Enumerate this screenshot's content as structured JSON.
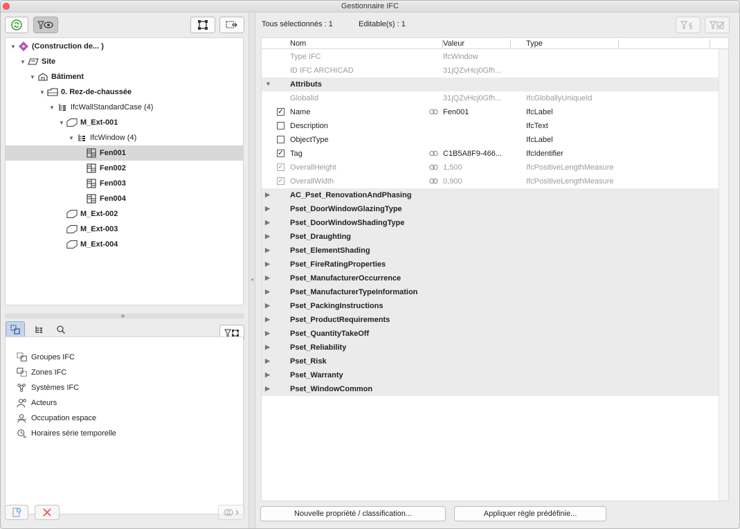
{
  "window": {
    "title": "Gestionnaire IFC"
  },
  "tree": [
    {
      "label": "(Construction de... )",
      "level": 0,
      "icon": "project-icon",
      "expanded": true
    },
    {
      "label": "Site",
      "level": 1,
      "icon": "site-icon",
      "expanded": true
    },
    {
      "label": "Bâtiment",
      "level": 2,
      "icon": "building-icon",
      "expanded": true
    },
    {
      "label": "0. Rez-de-chaussée",
      "level": 3,
      "icon": "storey-icon",
      "expanded": true
    },
    {
      "label": "IfcWallStandardCase (4)",
      "level": 4,
      "icon": "type-group-icon",
      "expanded": true,
      "normal": true
    },
    {
      "label": "M_Ext-001",
      "level": 5,
      "icon": "wall-icon",
      "expanded": true
    },
    {
      "label": "IfcWindow (4)",
      "level": 6,
      "icon": "type-group-icon",
      "expanded": true,
      "normal": true
    },
    {
      "label": "Fen001",
      "level": 7,
      "icon": "window-icon",
      "selected": true
    },
    {
      "label": "Fen002",
      "level": 7,
      "icon": "window-icon"
    },
    {
      "label": "Fen003",
      "level": 7,
      "icon": "window-icon"
    },
    {
      "label": "Fen004",
      "level": 7,
      "icon": "window-icon"
    },
    {
      "label": "M_Ext-002",
      "level": 5,
      "icon": "wall-icon"
    },
    {
      "label": "M_Ext-003",
      "level": 5,
      "icon": "wall-icon"
    },
    {
      "label": "M_Ext-004",
      "level": 5,
      "icon": "wall-icon"
    }
  ],
  "groups": [
    {
      "label": "Groupes IFC",
      "icon": "ifc-groups-icon"
    },
    {
      "label": "Zones IFC",
      "icon": "ifc-zones-icon"
    },
    {
      "label": "Systèmes IFC",
      "icon": "ifc-systems-icon"
    },
    {
      "label": "Acteurs",
      "icon": "actors-icon"
    },
    {
      "label": "Occupation espace",
      "icon": "space-occupancy-icon"
    },
    {
      "label": "Horaires série temporelle",
      "icon": "time-series-icon"
    }
  ],
  "info": {
    "selected": "Tous sélectionnés : 1",
    "editable": "Editable(s) : 1"
  },
  "columns": {
    "name": "Nom",
    "value": "Valeur",
    "type": "Type"
  },
  "rows": [
    {
      "kind": "grey",
      "name": "Type IFC",
      "value": "IfcWindow",
      "type": ""
    },
    {
      "kind": "grey",
      "name": "ID IFC ARCHICAD",
      "value": "31jQZvHcj0Gfh...",
      "type": ""
    },
    {
      "kind": "section",
      "name": "Attributs",
      "expanded": true
    },
    {
      "kind": "grey",
      "name": "GlobalId",
      "value": "31jQZvHcj0Gfh...",
      "type": "IfcGloballyUniqueId"
    },
    {
      "kind": "check",
      "checked": true,
      "name": "Name",
      "link": true,
      "value": "Fen001",
      "type": "IfcLabel"
    },
    {
      "kind": "check",
      "checked": false,
      "name": "Description",
      "value": "",
      "type": "IfcText"
    },
    {
      "kind": "check",
      "checked": false,
      "name": "ObjectType",
      "value": "",
      "type": "IfcLabel"
    },
    {
      "kind": "check",
      "checked": true,
      "name": "Tag",
      "link": true,
      "value": "C1B5A8F9-466...",
      "type": "IfcIdentifier"
    },
    {
      "kind": "check-dim",
      "checked": true,
      "name": "OverallHeight",
      "link": true,
      "value": "1,500",
      "type": "IfcPositiveLengthMeasure"
    },
    {
      "kind": "check-dim",
      "checked": true,
      "name": "OverallWidth",
      "link": true,
      "value": "0,900",
      "type": "IfcPositiveLengthMeasure"
    },
    {
      "kind": "section",
      "name": "AC_Pset_RenovationAndPhasing"
    },
    {
      "kind": "section",
      "name": "Pset_DoorWindowGlazingType"
    },
    {
      "kind": "section",
      "name": "Pset_DoorWindowShadingType"
    },
    {
      "kind": "section",
      "name": "Pset_Draughting"
    },
    {
      "kind": "section",
      "name": "Pset_ElementShading"
    },
    {
      "kind": "section",
      "name": "Pset_FireRatingProperties"
    },
    {
      "kind": "section",
      "name": "Pset_ManufacturerOccurrence"
    },
    {
      "kind": "section",
      "name": "Pset_ManufacturerTypeInformation"
    },
    {
      "kind": "section",
      "name": "Pset_PackingInstructions"
    },
    {
      "kind": "section",
      "name": "Pset_ProductRequirements"
    },
    {
      "kind": "section",
      "name": "Pset_QuantityTakeOff"
    },
    {
      "kind": "section",
      "name": "Pset_Reliability"
    },
    {
      "kind": "section",
      "name": "Pset_Risk"
    },
    {
      "kind": "section",
      "name": "Pset_Warranty"
    },
    {
      "kind": "section",
      "name": "Pset_WindowCommon"
    }
  ],
  "buttons": {
    "new_property": "Nouvelle propriété / classification...",
    "apply_rule": "Appliquer règle prédéfinie..."
  }
}
